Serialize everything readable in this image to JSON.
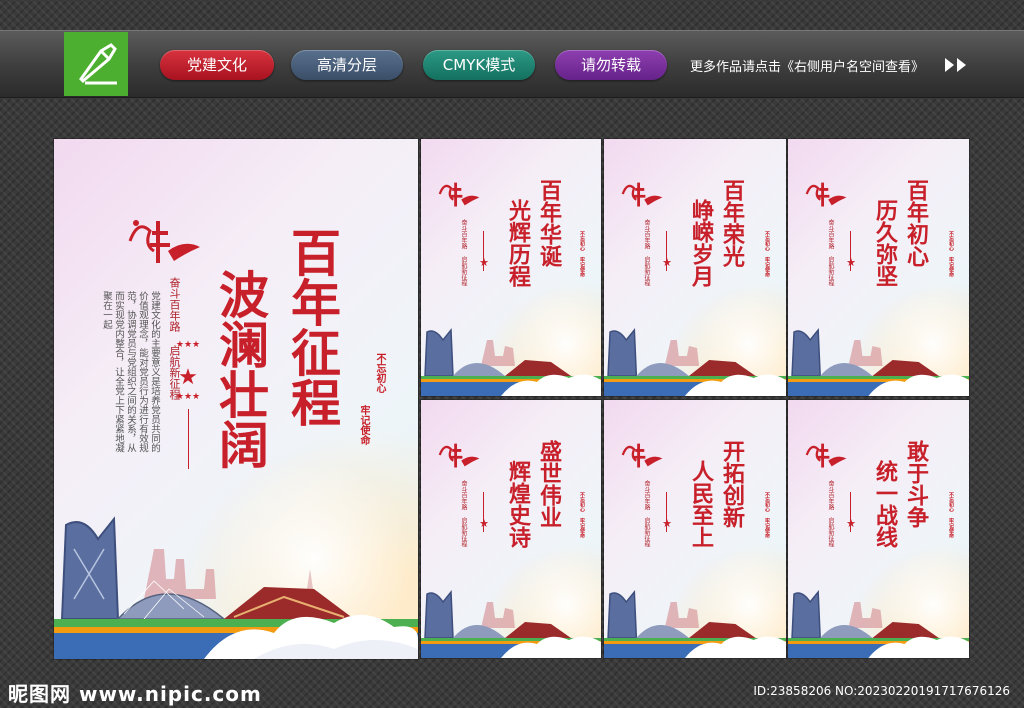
{
  "banner": {
    "pills": [
      "党建文化",
      "高清分层",
      "CMYK模式",
      "请勿转载"
    ],
    "more_text": "更多作品请点击《右侧用户名空间查看》"
  },
  "colors": {
    "accent_red": "#c8202a",
    "logo_green": "#4caf2f"
  },
  "main_poster": {
    "title": "百年征程",
    "title2": "波澜壮阔",
    "subtitle": "奋斗百年路 启航新征程",
    "body": "党建文化的主要意义是培养党员共同的价值观理念，能对党员行为进行有效规范，协调党员与党组织之间的关系，从而实现党内整合，让全党上下紧紧地凝聚在一起",
    "slogan_left": "不忘初心",
    "slogan_right": "牢记使命"
  },
  "small_posters": [
    {
      "line1": "百年华诞",
      "line2": "光辉历程"
    },
    {
      "line1": "百年荣光",
      "line2": "峥嵘岁月"
    },
    {
      "line1": "百年初心",
      "line2": "历久弥坚"
    },
    {
      "line1": "盛世伟业",
      "line2": "辉煌史诗"
    },
    {
      "line1": "开拓创新",
      "line2": "人民至上"
    },
    {
      "line1": "敢于斗争",
      "line2": "统一战线"
    }
  ],
  "small_subtitle": "奋斗百年路 启航新征程",
  "small_slogan": "不忘初心 牢记使命",
  "footer": {
    "site": "昵图网 www.nipic.com",
    "id_text": "ID:23858206 NO:20230220191717676126"
  }
}
